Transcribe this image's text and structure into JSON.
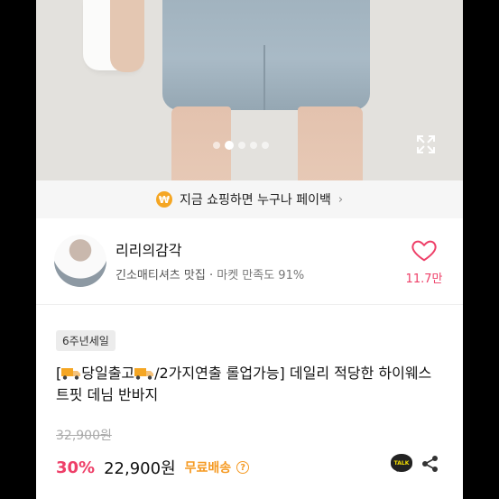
{
  "banner": {
    "text": "지금 쇼핑하면 누구나 페이백",
    "coin_symbol": "₩",
    "chevron": "›"
  },
  "image_carousel": {
    "dot_count": 5,
    "active_index": 1
  },
  "store": {
    "name": "리리의감각",
    "tagline": "긴소매티셔츠 맛집",
    "separator": "·",
    "satisfaction": "마켓 만족도 91%",
    "like_count": "11.7만"
  },
  "product": {
    "badge": "6주년세일",
    "title_part1": "[",
    "title_part2": "당일출고",
    "title_part3": "/2가지연출 롤업가능] 데일리 적당한 하이웨스트핏 데님 반바지",
    "original_price": "32,900원",
    "discount": "30%",
    "price": "22,900원",
    "shipping": "무료배송",
    "info_symbol": "?",
    "talk_label": "TALK"
  },
  "colors": {
    "accent_pink": "#ee3f68",
    "accent_orange": "#f59a23",
    "coin": "#f5a623"
  }
}
